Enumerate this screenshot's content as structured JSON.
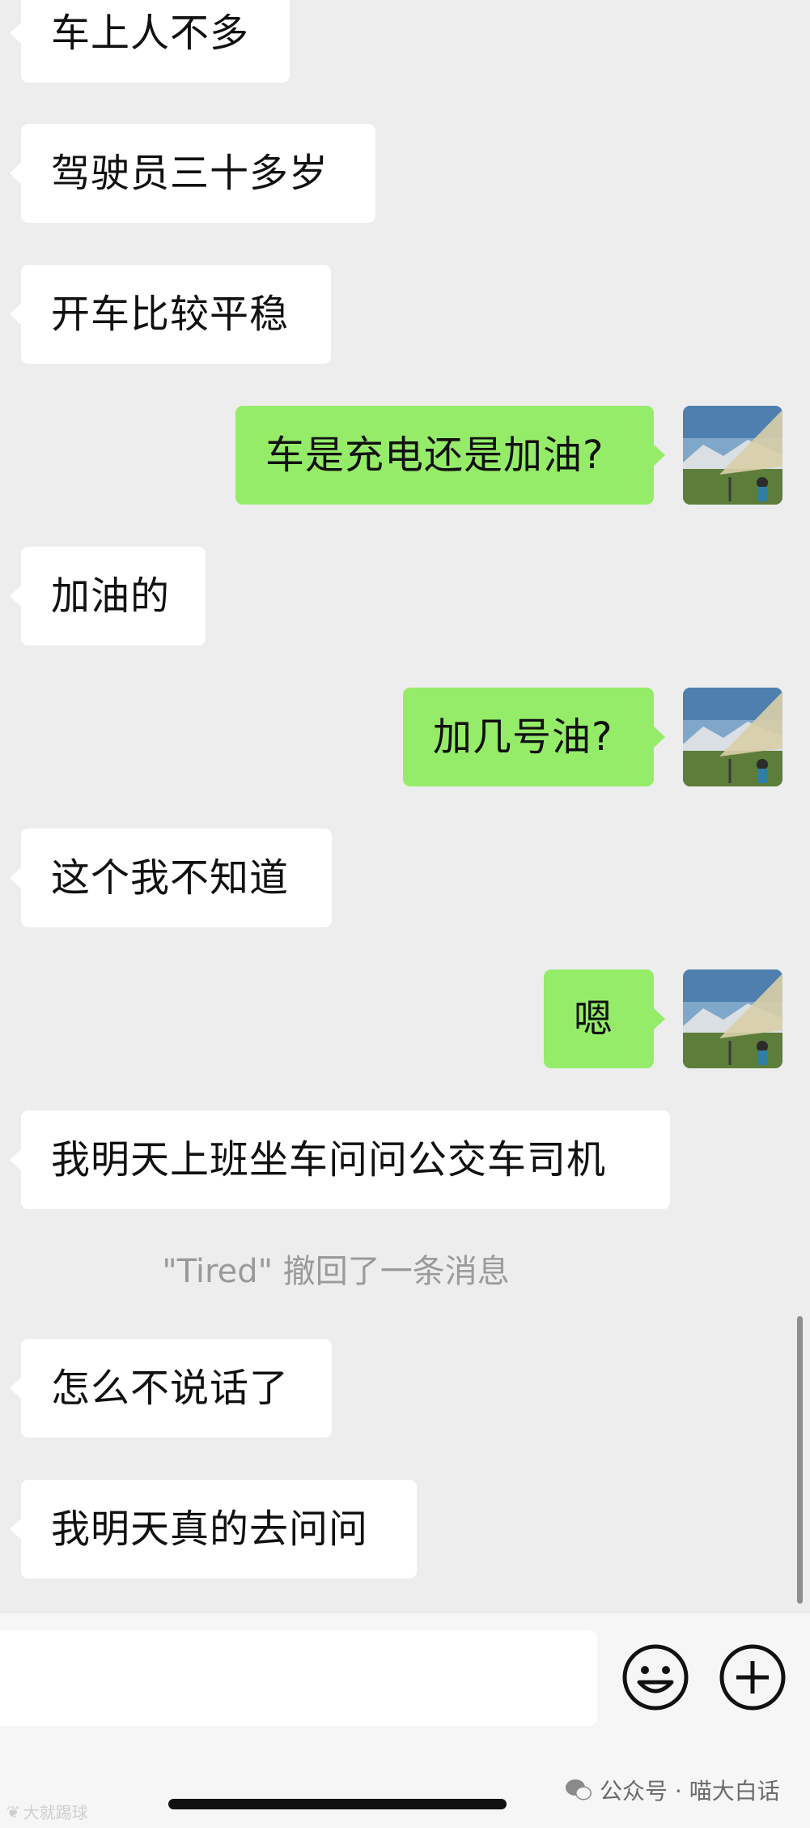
{
  "messages": [
    {
      "side": "in",
      "text": "车上人不多"
    },
    {
      "side": "in",
      "text": "驾驶员三十多岁"
    },
    {
      "side": "in",
      "text": "开车比较平稳"
    },
    {
      "side": "out",
      "text": "车是充电还是加油?"
    },
    {
      "side": "in",
      "text": "加油的"
    },
    {
      "side": "out",
      "text": "加几号油?"
    },
    {
      "side": "in",
      "text": "这个我不知道"
    },
    {
      "side": "out",
      "text": "嗯"
    },
    {
      "side": "in",
      "text": "我明天上班坐车问问公交车司机"
    },
    {
      "side": "in",
      "text": "怎么不说话了"
    },
    {
      "side": "in",
      "text": "我明天真的去问问"
    }
  ],
  "recall_notice": "\"Tired\" 撤回了一条消息",
  "input_bar": {
    "emoji_icon": "smiley-icon",
    "plus_icon": "plus-circle-icon"
  },
  "watermark": {
    "right": "公众号 · 喵大白话",
    "left": "大就踢球"
  },
  "colors": {
    "outgoing": "#95ec69",
    "incoming": "#ffffff",
    "background": "#ededed"
  }
}
